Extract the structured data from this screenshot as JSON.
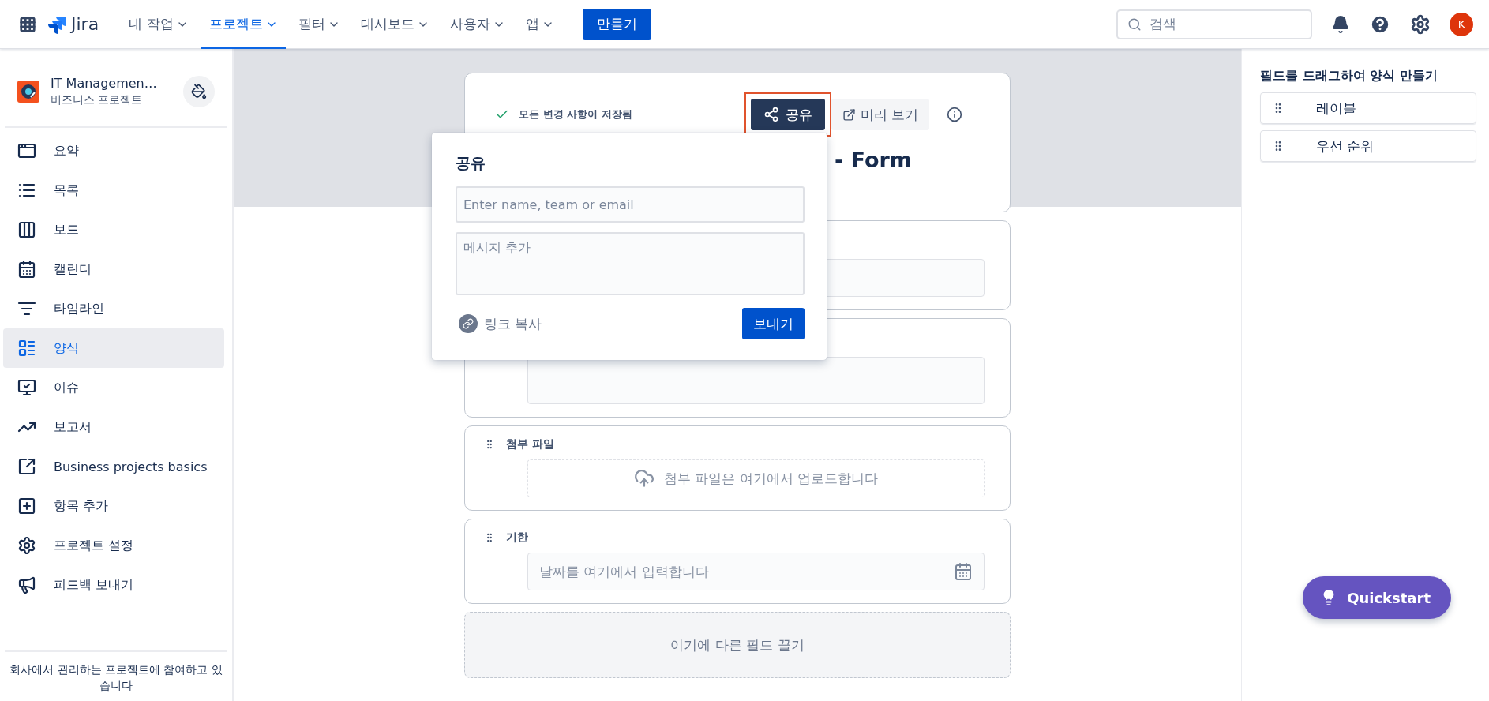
{
  "topnav": {
    "items": [
      {
        "label": "내 작업",
        "selected": false
      },
      {
        "label": "프로젝트",
        "selected": true
      },
      {
        "label": "필터",
        "selected": false
      },
      {
        "label": "대시보드",
        "selected": false
      },
      {
        "label": "사용자",
        "selected": false
      },
      {
        "label": "앱",
        "selected": false
      }
    ],
    "product": "Jira",
    "create_button": "만들기",
    "search": {
      "placeholder": "검색"
    },
    "avatar": "K"
  },
  "sidebar": {
    "project_name": "IT Managemen…",
    "project_type": "비즈니스 프로젝트",
    "items": [
      {
        "label": "요약",
        "selected": false
      },
      {
        "label": "목록",
        "selected": false
      },
      {
        "label": "보드",
        "selected": false
      },
      {
        "label": "캘린더",
        "selected": false
      },
      {
        "label": "타임라인",
        "selected": false
      },
      {
        "label": "양식",
        "selected": true
      },
      {
        "label": "이슈",
        "selected": false
      },
      {
        "label": "보고서",
        "selected": false
      },
      {
        "label": "Business projects basics",
        "selected": false
      },
      {
        "label": "항목 추가",
        "selected": false
      },
      {
        "label": "프로젝트 설정",
        "selected": false
      },
      {
        "label": "피드백 보내기",
        "selected": false
      }
    ],
    "footer": "회사에서 관리하는 프로젝트에 참여하고 있습니다"
  },
  "form": {
    "saved_status": "모든 변경 사항이 저장됨",
    "share_button": {
      "label": "공유",
      "highlighted": true
    },
    "preview_button": "미리 보기",
    "title": "- Form",
    "fields": [
      {
        "kind": "input"
      },
      {
        "kind": "textarea"
      },
      {
        "kind": "attachment",
        "label": "첨부 파일",
        "placeholder": "첨부 파일은 여기에서 업로드합니다"
      },
      {
        "kind": "date",
        "label": "기한",
        "placeholder": "날짜를 여기에서 입력합니다"
      }
    ],
    "drop_zone": "여기에 다른 필드 끌기"
  },
  "share_popover": {
    "title": "공유",
    "recipient": {
      "placeholder": "Enter name, team or email"
    },
    "message": {
      "placeholder": "메시지 추가"
    },
    "copy_link": "링크 복사",
    "send_button": "보내기"
  },
  "field_panel": {
    "title": "필드를 드래그하여 양식 만들기",
    "items": [
      "레이블",
      "우선 순위"
    ]
  },
  "quickstart": "Quickstart"
}
